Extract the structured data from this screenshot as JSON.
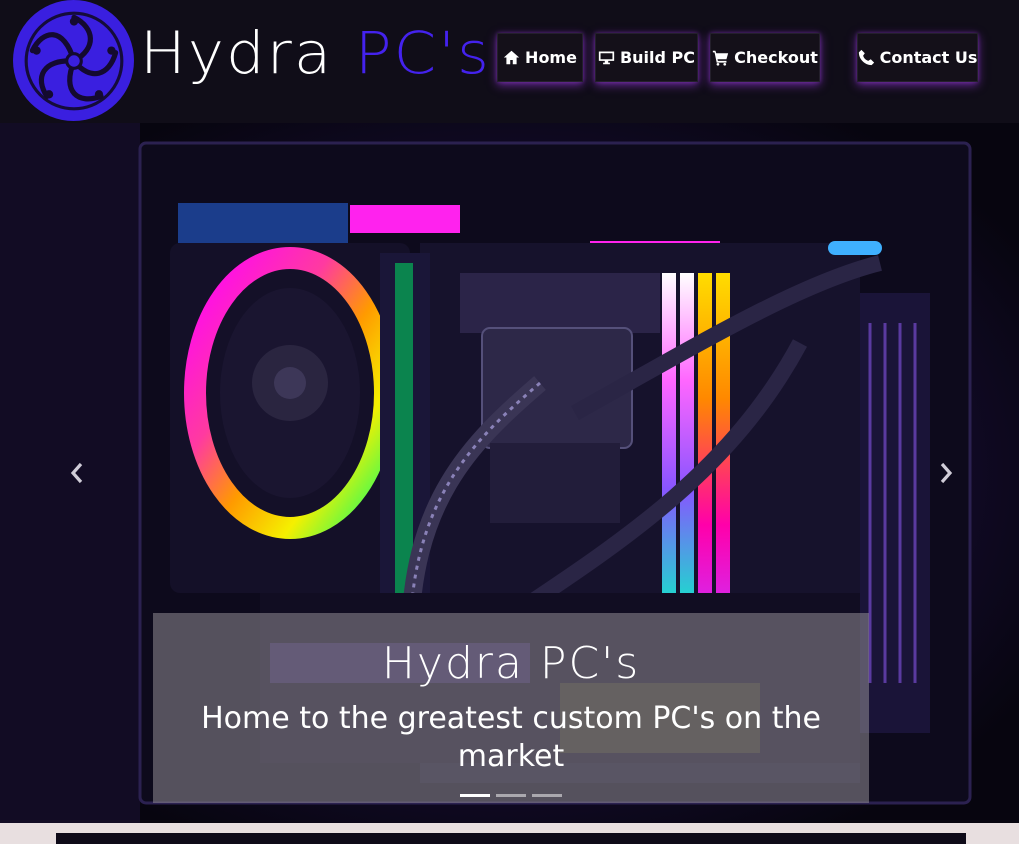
{
  "header": {
    "brand_main": "Hydra",
    "brand_accent": "PC's",
    "nav": [
      {
        "label": "Home",
        "icon": "home-icon"
      },
      {
        "label": "Build PC",
        "icon": "desktop-icon"
      },
      {
        "label": "Checkout",
        "icon": "cart-icon"
      },
      {
        "label": "Contact Us",
        "icon": "phone-icon"
      }
    ]
  },
  "carousel": {
    "caption_title": "Hydra PC's",
    "caption_text": "Home to the greatest custom PC's on the market",
    "slide_count": 3,
    "active_slide": 1
  },
  "colors": {
    "header_bg": "#100d18",
    "brand_accent": "#4422ee",
    "logo_bg": "#3a1fe0",
    "button_glow": "#ae40ff"
  }
}
